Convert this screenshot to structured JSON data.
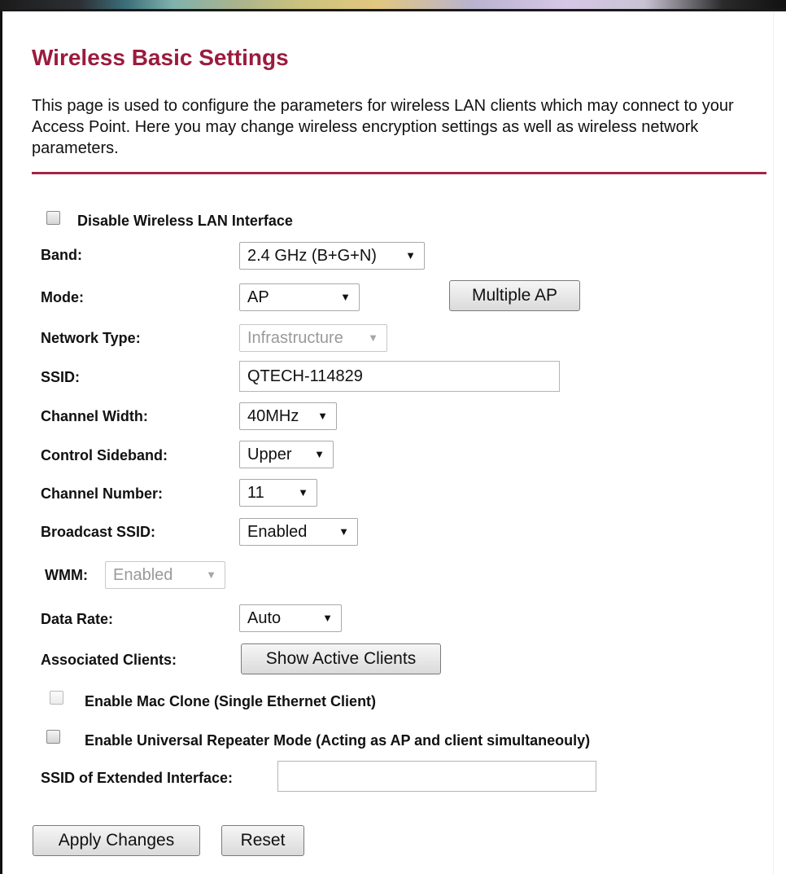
{
  "page": {
    "title": "Wireless Basic Settings",
    "description": "This page is used to configure the parameters for wireless LAN clients which may connect to your Access Point. Here you may change wireless encryption settings as well as wireless network parameters."
  },
  "form": {
    "disable_wlan": {
      "label": "Disable Wireless LAN Interface",
      "checked": false
    },
    "band": {
      "label": "Band:",
      "value": "2.4 GHz (B+G+N)"
    },
    "mode": {
      "label": "Mode:",
      "value": "AP",
      "button_label": "Multiple AP"
    },
    "network_type": {
      "label": "Network Type:",
      "value": "Infrastructure",
      "disabled": true
    },
    "ssid": {
      "label": "SSID:",
      "value": "QTECH-114829"
    },
    "channel_width": {
      "label": "Channel Width:",
      "value": "40MHz"
    },
    "control_sideband": {
      "label": "Control Sideband:",
      "value": "Upper"
    },
    "channel_number": {
      "label": "Channel Number:",
      "value": "11"
    },
    "broadcast_ssid": {
      "label": "Broadcast SSID:",
      "value": "Enabled"
    },
    "wmm": {
      "label": "WMM:",
      "value": "Enabled",
      "disabled": true
    },
    "data_rate": {
      "label": "Data Rate:",
      "value": "Auto"
    },
    "associated_clients": {
      "label": "Associated Clients:",
      "button_label": "Show Active Clients"
    },
    "mac_clone": {
      "label": "Enable Mac Clone (Single Ethernet Client)",
      "checked": false,
      "disabled": true
    },
    "repeater": {
      "label": "Enable Universal Repeater Mode (Acting as AP and client simultaneouly)",
      "checked": false
    },
    "extended_ssid": {
      "label": "SSID of Extended Interface:",
      "value": ""
    }
  },
  "actions": {
    "apply_label": "Apply Changes",
    "reset_label": "Reset"
  },
  "icons": {
    "dropdown_arrow": "chevron-down-icon"
  },
  "colors": {
    "title": "#9b1b3d",
    "divider": "#a0264a"
  }
}
